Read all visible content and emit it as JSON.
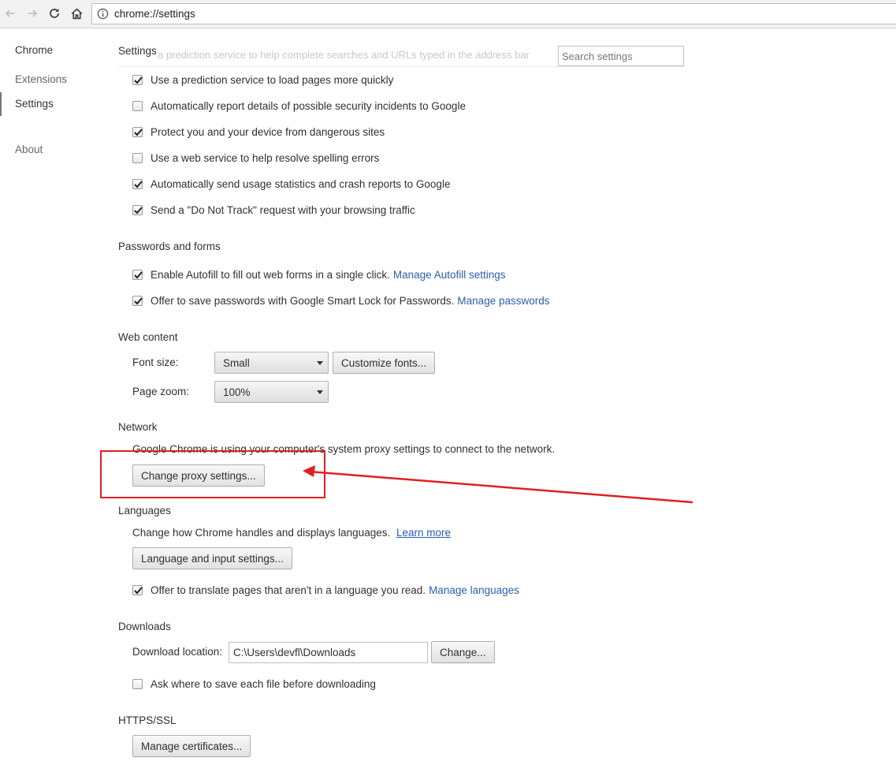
{
  "browser": {
    "url": "chrome://settings",
    "back_icon": "back-arrow-icon",
    "forward_icon": "forward-arrow-icon",
    "reload_icon": "reload-icon",
    "home_icon": "home-icon",
    "info_icon": "info-icon"
  },
  "sidebar": {
    "heading": "Chrome",
    "items": [
      {
        "label": "Extensions"
      },
      {
        "label": "Settings"
      },
      {
        "label": "About"
      }
    ]
  },
  "page": {
    "title": "Settings",
    "ghost_text": "a prediction service to help complete searches and URLs typed in the address bar",
    "search_placeholder": "Search settings"
  },
  "privacy": {
    "options": [
      {
        "label": "Use a prediction service to load pages more quickly",
        "checked": true
      },
      {
        "label": "Automatically report details of possible security incidents to Google",
        "checked": false
      },
      {
        "label": "Protect you and your device from dangerous sites",
        "checked": true
      },
      {
        "label": "Use a web service to help resolve spelling errors",
        "checked": false
      },
      {
        "label": "Automatically send usage statistics and crash reports to Google",
        "checked": true
      },
      {
        "label": "Send a \"Do Not Track\" request with your browsing traffic",
        "checked": true
      }
    ]
  },
  "passwords": {
    "title": "Passwords and forms",
    "autofill_label": "Enable Autofill to fill out web forms in a single click.",
    "autofill_link": "Manage Autofill settings",
    "autofill_checked": true,
    "save_label": "Offer to save passwords with Google Smart Lock for Passwords.",
    "save_link": "Manage passwords",
    "save_checked": true
  },
  "web_content": {
    "title": "Web content",
    "font_size_label": "Font size:",
    "font_size_value": "Small",
    "customize_fonts_label": "Customize fonts...",
    "page_zoom_label": "Page zoom:",
    "page_zoom_value": "100%"
  },
  "network": {
    "title": "Network",
    "description": "Google Chrome is using your computer's system proxy settings to connect to the network.",
    "proxy_button": "Change proxy settings..."
  },
  "languages": {
    "title": "Languages",
    "description": "Change how Chrome handles and displays languages.",
    "learn_more": "Learn more",
    "settings_button": "Language and input settings...",
    "translate_label": "Offer to translate pages that aren't in a language you read.",
    "translate_link": "Manage languages",
    "translate_checked": true
  },
  "downloads": {
    "title": "Downloads",
    "location_label": "Download location:",
    "location_value": "C:\\Users\\devfl\\Downloads",
    "change_button": "Change...",
    "ask_label": "Ask where to save each file before downloading",
    "ask_checked": false
  },
  "https": {
    "title": "HTTPS/SSL",
    "certificates_button": "Manage certificates..."
  },
  "colors": {
    "annotation": "#e02020",
    "link": "#2a5db0"
  }
}
